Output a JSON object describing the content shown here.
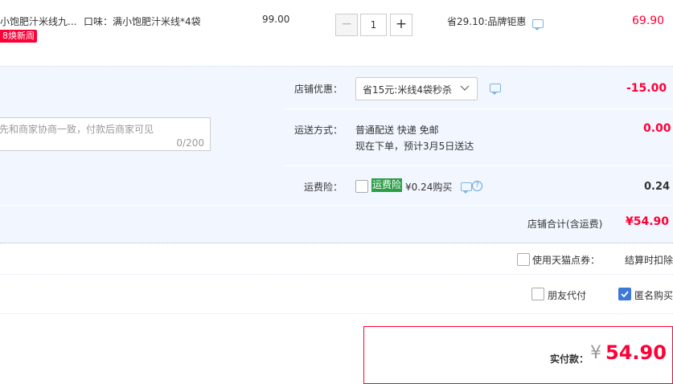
{
  "product": {
    "title": "小饱肥汁米线九...",
    "spec": "口味：满小饱肥汁米线*4袋",
    "badge": "8焕新周",
    "unit_price": "99.00",
    "quantity": "1",
    "minus": "−",
    "plus": "+",
    "discount": "省29.10:品牌钜惠",
    "subtotal": "69.90"
  },
  "shop": {
    "promo_label": "店铺优惠：",
    "promo_value": "省15元:米线4袋秒杀",
    "promo_amount": "-15.00",
    "memo_placeholder": "先和商家协商一致，付款后商家可见",
    "memo_count": "0/200",
    "shipping_label": "运送方式：",
    "shipping_value": "普通配送 快递 免邮",
    "shipping_eta": "现在下单，预计3月5日送达",
    "shipping_amount": "0.00",
    "insurance_label": "运费险：",
    "insurance_tag": "运费险",
    "insurance_price": "¥0.24购买",
    "insurance_amount": "0.24",
    "total_label": "店铺合计(含运费)",
    "total_value": "¥54.90"
  },
  "options": {
    "points_label": "使用天猫点券：",
    "points_note": "结算时扣除",
    "friend_pay_label": "朋友代付",
    "anonymous_label": "匿名购买",
    "anonymous_checked": true
  },
  "payment": {
    "label": "实付款：",
    "currency": "¥",
    "amount": "54.90"
  },
  "colors": {
    "accent_red": "#ff0036",
    "shop_bg": "#f2f7ff",
    "insurance_green": "#2d9e48",
    "checkbox_blue": "#3c78d8"
  }
}
